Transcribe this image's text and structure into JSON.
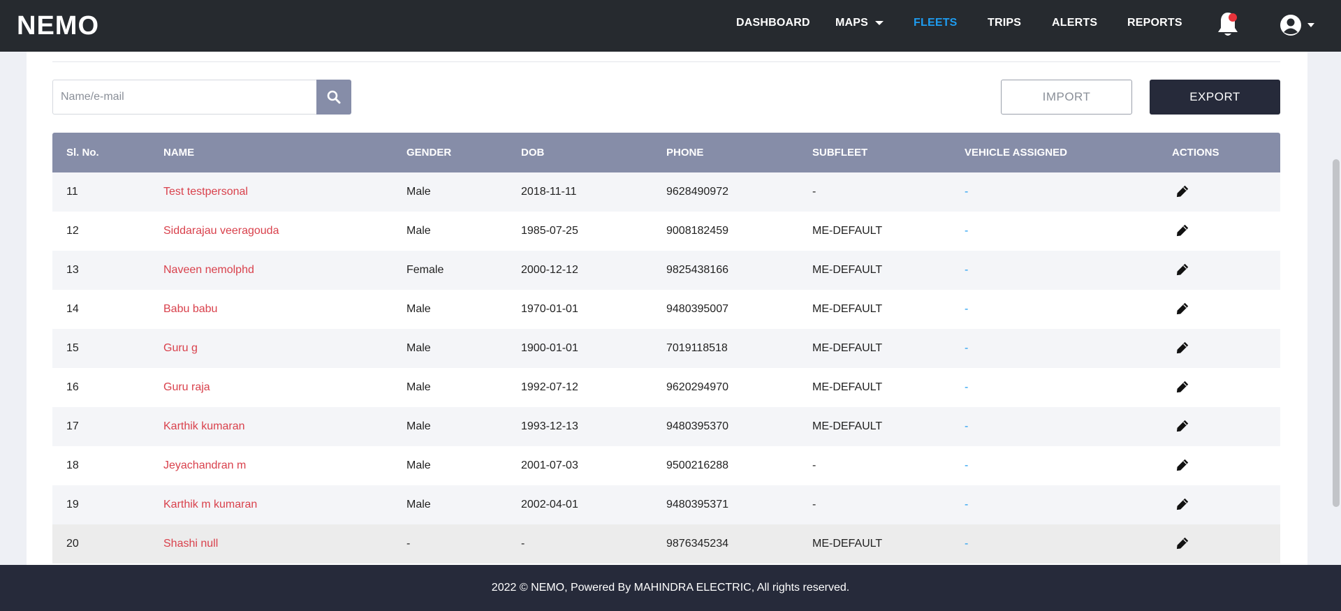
{
  "brand": {
    "logo": "NEMO"
  },
  "nav": {
    "items": [
      {
        "label": "DASHBOARD"
      },
      {
        "label": "MAPS"
      },
      {
        "label": "FLEETS",
        "active": true
      },
      {
        "label": "TRIPS"
      },
      {
        "label": "ALERTS"
      },
      {
        "label": "REPORTS"
      }
    ]
  },
  "toolbar": {
    "search_placeholder": "Name/e-mail",
    "import_label": "IMPORT",
    "export_label": "EXPORT"
  },
  "table": {
    "columns": [
      "Sl. No.",
      "NAME",
      "GENDER",
      "DOB",
      "PHONE",
      "SUBFLEET",
      "VEHICLE ASSIGNED",
      "ACTIONS"
    ],
    "rows": [
      {
        "sl": "11",
        "name": "Test testpersonal",
        "gender": "Male",
        "dob": "2018-11-11",
        "phone": "9628490972",
        "subfleet": "-",
        "vehicle": "-"
      },
      {
        "sl": "12",
        "name": "Siddarajau veeragouda",
        "gender": "Male",
        "dob": "1985-07-25",
        "phone": "9008182459",
        "subfleet": "ME-DEFAULT",
        "vehicle": "-"
      },
      {
        "sl": "13",
        "name": "Naveen nemolphd",
        "gender": "Female",
        "dob": "2000-12-12",
        "phone": "9825438166",
        "subfleet": "ME-DEFAULT",
        "vehicle": "-"
      },
      {
        "sl": "14",
        "name": "Babu babu",
        "gender": "Male",
        "dob": "1970-01-01",
        "phone": "9480395007",
        "subfleet": "ME-DEFAULT",
        "vehicle": "-"
      },
      {
        "sl": "15",
        "name": "Guru g",
        "gender": "Male",
        "dob": "1900-01-01",
        "phone": "7019118518",
        "subfleet": "ME-DEFAULT",
        "vehicle": "-"
      },
      {
        "sl": "16",
        "name": "Guru raja",
        "gender": "Male",
        "dob": "1992-07-12",
        "phone": "9620294970",
        "subfleet": "ME-DEFAULT",
        "vehicle": "-"
      },
      {
        "sl": "17",
        "name": "Karthik kumaran",
        "gender": "Male",
        "dob": "1993-12-13",
        "phone": "9480395370",
        "subfleet": "ME-DEFAULT",
        "vehicle": "-"
      },
      {
        "sl": "18",
        "name": "Jeyachandran m",
        "gender": "Male",
        "dob": "2001-07-03",
        "phone": "9500216288",
        "subfleet": "-",
        "vehicle": "-"
      },
      {
        "sl": "19",
        "name": "Karthik m kumaran",
        "gender": "Male",
        "dob": "2002-04-01",
        "phone": "9480395371",
        "subfleet": "-",
        "vehicle": "-"
      },
      {
        "sl": "20",
        "name": "Shashi null",
        "gender": "-",
        "dob": "-",
        "phone": "9876345234",
        "subfleet": "ME-DEFAULT",
        "vehicle": "-"
      }
    ]
  },
  "footer": {
    "text": "2022 © NEMO, Powered By MAHINDRA ELECTRIC, All rights reserved."
  },
  "colors": {
    "nav_bg": "#262a2f",
    "active": "#1e9cf0",
    "name_link": "#d9414c",
    "table_header": "#868da8",
    "footer_bg": "#262a3a"
  }
}
